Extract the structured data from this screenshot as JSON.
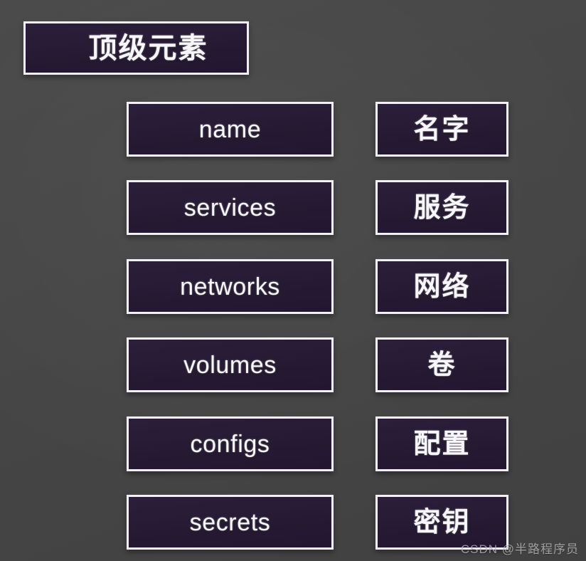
{
  "background_color": "#464646",
  "box_fill_color": "#261a33",
  "box_border_color": "#f2f0f4",
  "text_color": "#f7f6fa",
  "title": {
    "label": "顶级元素"
  },
  "rows": [
    {
      "key": "name",
      "value": "名字"
    },
    {
      "key": "services",
      "value": "服务"
    },
    {
      "key": "networks",
      "value": "网络"
    },
    {
      "key": "volumes",
      "value": "卷"
    },
    {
      "key": "configs",
      "value": "配置"
    },
    {
      "key": "secrets",
      "value": "密钥"
    }
  ],
  "watermark": {
    "text": "CSDN @半路程序员"
  }
}
